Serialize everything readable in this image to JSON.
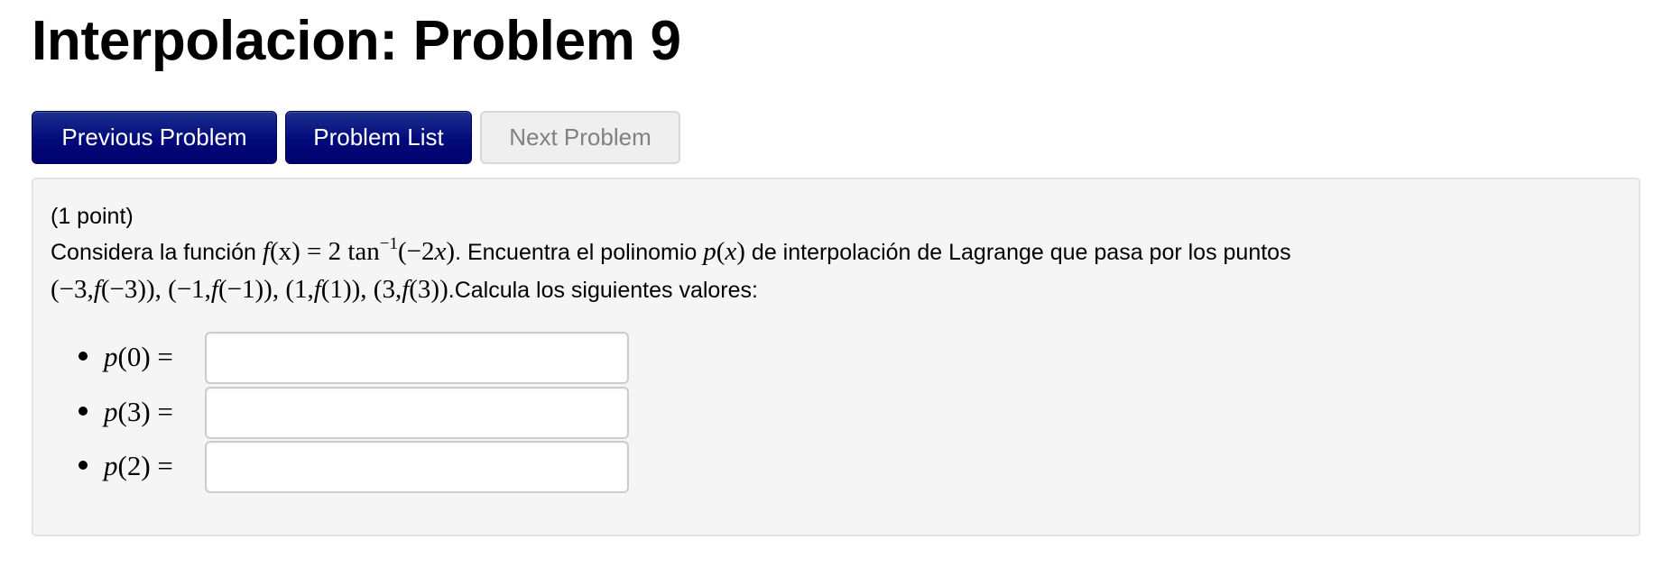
{
  "header": {
    "title": "Interpolacion: Problem 9"
  },
  "nav": {
    "previous_label": "Previous Problem",
    "list_label": "Problem List",
    "next_label": "Next Problem",
    "next_disabled": true
  },
  "colors": {
    "primary_button": "#020a7a",
    "disabled_button_bg": "#efefef",
    "disabled_button_text": "#818181",
    "panel_bg": "#f5f5f5"
  },
  "problem": {
    "points": "(1 point)",
    "intro": "Considera la función ",
    "func_lhs_f": "f",
    "func_lhs_arg": "(x) = 2 tan",
    "func_sup": "−1",
    "func_rhs": "(−2",
    "func_rhs_x": "x",
    "func_rhs_close": ")",
    "after_func": ". Encuentra el polinomio ",
    "poly_p": "p",
    "poly_open": "(",
    "poly_x": "x",
    "poly_close": ")",
    "after_poly": " de interpolación de Lagrange que pasa por los puntos",
    "points_list": [
      {
        "x": "−3",
        "fx": "−3"
      },
      {
        "x": "−1",
        "fx": "−1"
      },
      {
        "x": "1",
        "fx": "1"
      },
      {
        "x": "3",
        "fx": "3"
      }
    ],
    "after_points": ".Calcula los siguientes valores:"
  },
  "answers": [
    {
      "fn": "p",
      "arg": "(0) =",
      "value": "",
      "placeholder": ""
    },
    {
      "fn": "p",
      "arg": "(3) =",
      "value": "",
      "placeholder": ""
    },
    {
      "fn": "p",
      "arg": "(2) =",
      "value": "",
      "placeholder": ""
    }
  ]
}
